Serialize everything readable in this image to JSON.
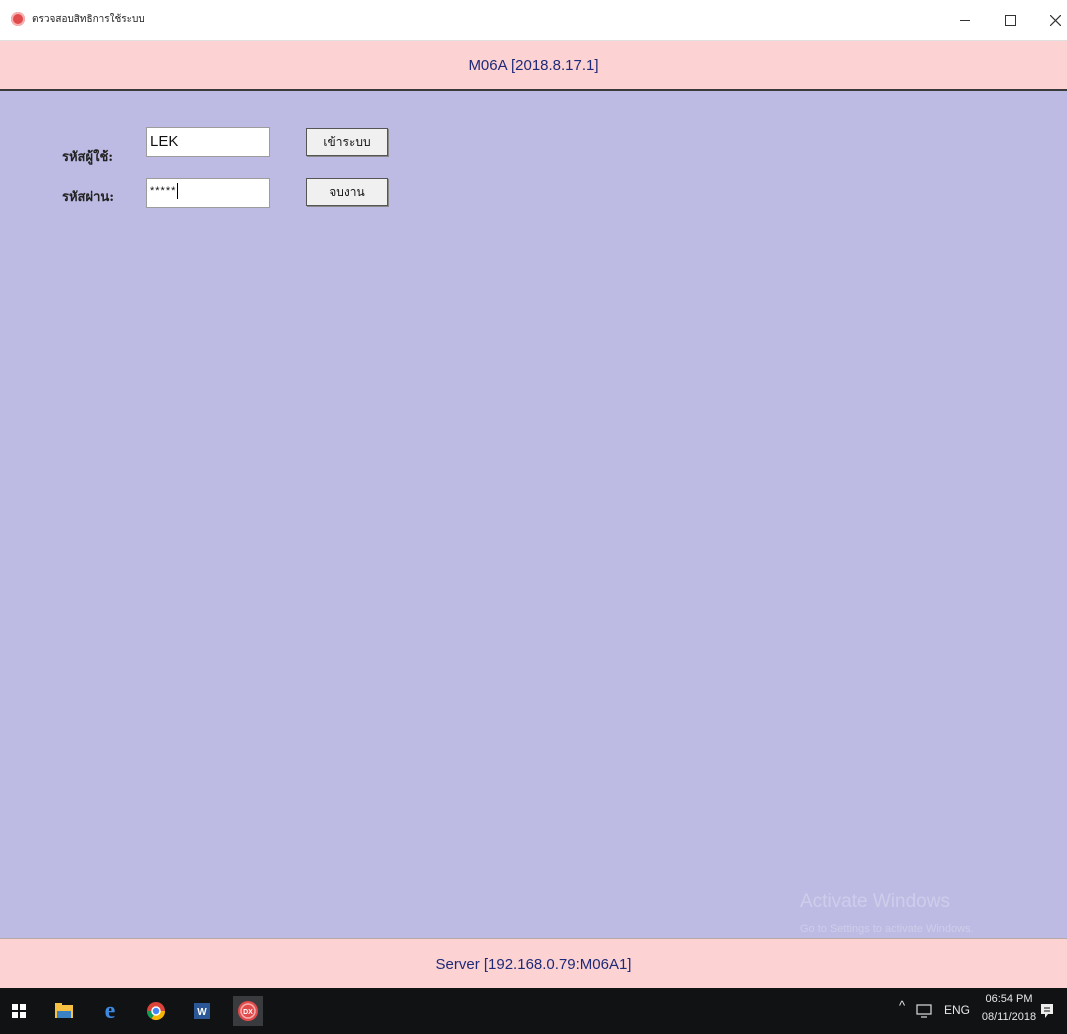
{
  "window": {
    "title": "ตรวจสอบสิทธิการใช้ระบบ"
  },
  "header": {
    "version": "M06A [2018.8.17.1]"
  },
  "login": {
    "username_label": "รหัสผู้ใช้:",
    "username_value": "LEK",
    "password_label": "รหัสผ่าน:",
    "password_value": "*****",
    "login_button": "เข้าระบบ",
    "exit_button": "จบงาน"
  },
  "watermark": {
    "line1": "Activate Windows",
    "line2": "Go to Settings to activate Windows."
  },
  "footer": {
    "server": "Server [192.168.0.79:M06A1]"
  },
  "taskbar": {
    "lang": "ENG",
    "time": "06:54 PM",
    "date": "08/11/2018",
    "app_badge": "DX"
  },
  "colors": {
    "main_background": "#bdbbe3",
    "band_background": "#fcd2d2",
    "band_text": "#1e2a78",
    "taskbar": "#111214"
  }
}
